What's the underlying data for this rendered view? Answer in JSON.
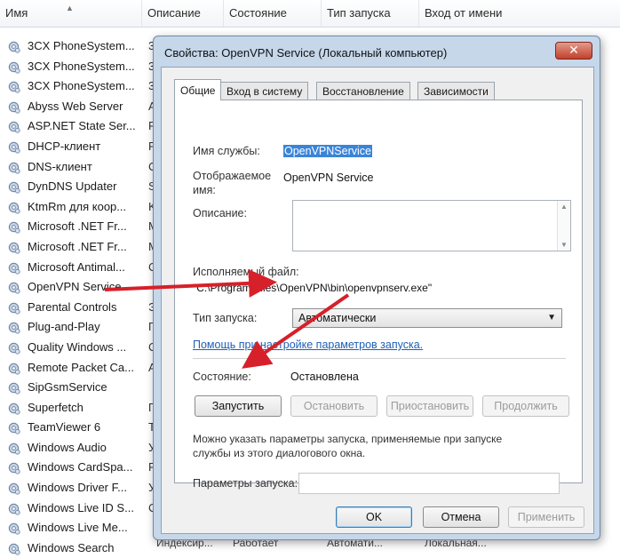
{
  "columns": [
    "Имя",
    "Описание",
    "Состояние",
    "Тип запуска",
    "Вход от имени"
  ],
  "services": [
    {
      "name": "3CX PhoneSystem...",
      "desc": "3"
    },
    {
      "name": "3CX PhoneSystem...",
      "desc": "3"
    },
    {
      "name": "3CX PhoneSystem...",
      "desc": "3"
    },
    {
      "name": "Abyss Web Server",
      "desc": "A"
    },
    {
      "name": "ASP.NET State Ser...",
      "desc": "P"
    },
    {
      "name": "DHCP-клиент",
      "desc": "P"
    },
    {
      "name": "DNS-клиент",
      "desc": "C"
    },
    {
      "name": "DynDNS Updater",
      "desc": "S"
    },
    {
      "name": "KtmRm для коор...",
      "desc": "K"
    },
    {
      "name": "Microsoft .NET Fr...",
      "desc": "M"
    },
    {
      "name": "Microsoft .NET Fr...",
      "desc": "M"
    },
    {
      "name": "Microsoft Antimal...",
      "desc": "C"
    },
    {
      "name": "OpenVPN Service",
      "desc": ""
    },
    {
      "name": "Parental Controls",
      "desc": "Э"
    },
    {
      "name": "Plug-and-Play",
      "desc": "П"
    },
    {
      "name": "Quality Windows ...",
      "desc": "C"
    },
    {
      "name": "Remote Packet Ca...",
      "desc": "A"
    },
    {
      "name": "SipGsmService",
      "desc": ""
    },
    {
      "name": "Superfetch",
      "desc": "П"
    },
    {
      "name": "TeamViewer 6",
      "desc": "T"
    },
    {
      "name": "Windows Audio",
      "desc": "У"
    },
    {
      "name": "Windows CardSpa...",
      "desc": "P"
    },
    {
      "name": "Windows Driver F...",
      "desc": "У"
    },
    {
      "name": "Windows Live ID S...",
      "desc": "C"
    },
    {
      "name": "Windows Live Me...",
      "desc": ""
    },
    {
      "name": "Windows Search",
      "desc": ""
    }
  ],
  "bottom_row": {
    "desc": "Индексир...",
    "state": "Работает",
    "startup": "Автомати...",
    "logon": "Локальная..."
  },
  "dialog": {
    "title": "Свойства: OpenVPN Service (Локальный компьютер)",
    "close": "✕",
    "tabs": [
      "Общие",
      "Вход в систему",
      "Восстановление",
      "Зависимости"
    ],
    "service_name_label": "Имя службы:",
    "service_name": "OpenVPNService",
    "display_name_label_1": "Отображаемое",
    "display_name_label_2": "имя:",
    "display_name": "OpenVPN Service",
    "description_label": "Описание:",
    "exe_label": "Исполняемый файл:",
    "exe_path": "\"C:\\Program Files\\OpenVPN\\bin\\openvpnserv.exe\"",
    "startup_type_label": "Тип запуска:",
    "startup_type": "Автоматически",
    "help_link": "Помощь при настройке параметров запуска.",
    "status_label": "Состояние:",
    "status": "Остановлена",
    "btn_start": "Запустить",
    "btn_stop": "Остановить",
    "btn_pause": "Приостановить",
    "btn_resume": "Продолжить",
    "hint_line1": "Можно указать параметры запуска, применяемые при запуске",
    "hint_line2": "службы из этого диалогового окна.",
    "params_label": "Параметры запуска:",
    "params_value": "",
    "btn_ok": "OK",
    "btn_cancel": "Отмена",
    "btn_apply": "Применить"
  },
  "colors": {
    "arrow": "#d6202a",
    "selection": "#3a84d8",
    "link": "#1f5fb5"
  }
}
